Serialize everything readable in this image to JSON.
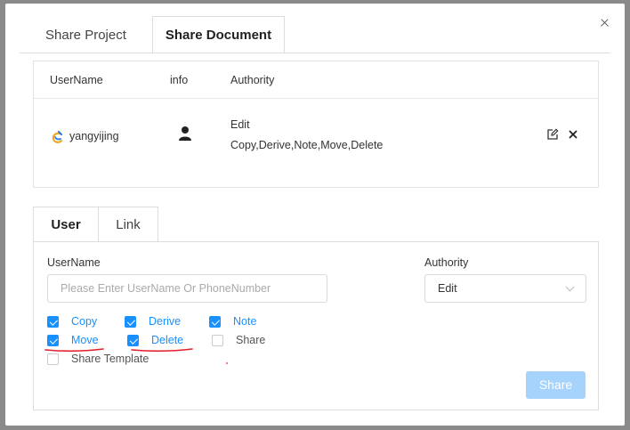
{
  "dialog": {
    "close_label": "×"
  },
  "top_tabs": [
    {
      "label": "Share Project",
      "active": false
    },
    {
      "label": "Share Document",
      "active": true
    }
  ],
  "users_table": {
    "headers": {
      "username": "UserName",
      "info": "info",
      "authority": "Authority"
    },
    "rows": [
      {
        "username": "yangyijing",
        "authority_level": "Edit",
        "permissions": "Copy,Derive,Note,Move,Delete"
      }
    ]
  },
  "sub_tabs": [
    {
      "label": "User",
      "active": true
    },
    {
      "label": "Link",
      "active": false
    }
  ],
  "form": {
    "username_label": "UserName",
    "username_placeholder": "Please Enter UserName Or PhoneNumber",
    "username_value": "",
    "authority_label": "Authority",
    "authority_value": "Edit",
    "checkboxes": [
      {
        "label": "Copy",
        "checked": true
      },
      {
        "label": "Derive",
        "checked": true
      },
      {
        "label": "Note",
        "checked": true
      },
      {
        "label": "Move",
        "checked": true
      },
      {
        "label": "Delete",
        "checked": true
      },
      {
        "label": "Share",
        "checked": false
      },
      {
        "label": "Share Template",
        "checked": false
      }
    ],
    "share_button": "Share"
  },
  "colors": {
    "accent": "#1890ff",
    "button_disabled": "#a6d3fc",
    "annotation": "#e0202a"
  }
}
